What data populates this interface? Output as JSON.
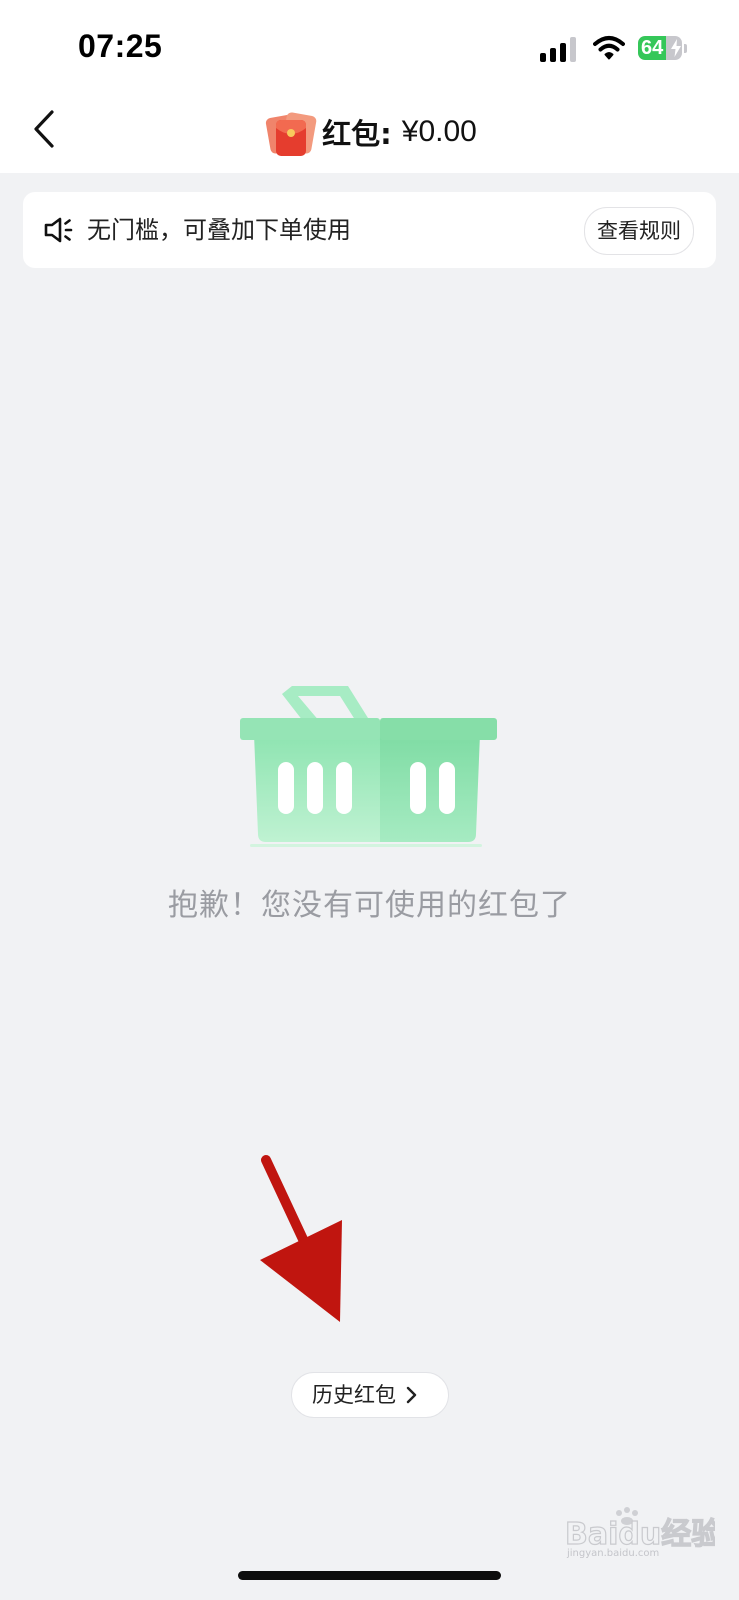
{
  "status_bar": {
    "time": "07:25",
    "battery_level": "64",
    "icons": [
      "signal-icon",
      "wifi-icon",
      "battery-icon",
      "charging-bolt-icon"
    ]
  },
  "nav": {
    "back_icon": "chevron-left-icon",
    "title_icon": "red-packet-icon",
    "title_label": "红包:",
    "title_amount": "¥0.00"
  },
  "notice": {
    "icon": "speaker-icon",
    "text": "无门槛，可叠加下单使用",
    "rules_label": "查看规则"
  },
  "empty_state": {
    "illustration": "empty-basket-icon",
    "message": "抱歉！您没有可使用的红包了"
  },
  "history": {
    "label": "历史红包",
    "icon": "chevron-right-icon"
  },
  "annotation": {
    "icon": "red-arrow-annotation",
    "color": "#c0150f"
  },
  "watermark": {
    "text": "Baidu经验",
    "subtext": "jingyan.baidu.com"
  },
  "colors": {
    "background": "#f1f2f4",
    "surface": "#ffffff",
    "basket_green": "#8fe0ae",
    "muted_text": "#9a9ca2",
    "battery_green": "#35c759"
  }
}
